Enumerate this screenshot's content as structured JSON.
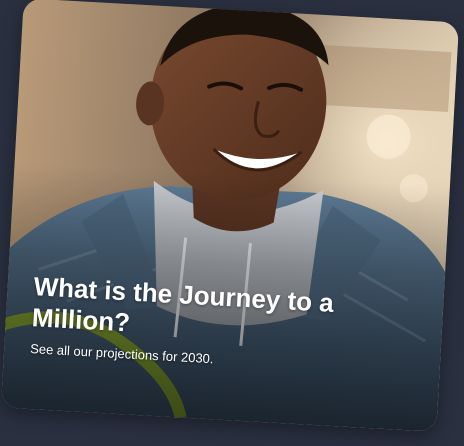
{
  "card": {
    "title": "What is the Journey to a Million?",
    "subtitle": "See all our projections for 2030."
  },
  "colors": {
    "page_background": "#2a3040",
    "accent_arc": "#8fae2a",
    "text": "#ffffff"
  }
}
